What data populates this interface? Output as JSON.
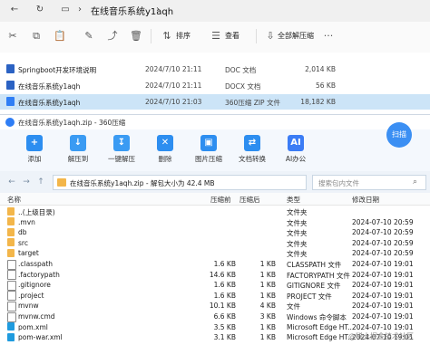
{
  "explorer": {
    "breadcrumb": "在线音乐系统y1aqh",
    "toolbar": {
      "sort_label": "排序",
      "view_label": "查看",
      "extract_all_label": "全部解压缩"
    },
    "files": [
      {
        "name": "Springboot开发环境说明",
        "date": "2024/7/10 21:11",
        "type": "DOC 文档",
        "size": "2,014 KB",
        "icon_color": "#2b62c3",
        "selected": false
      },
      {
        "name": "在线音乐系统y1aqh",
        "date": "2024/7/10 21:11",
        "type": "DOCX 文档",
        "size": "56 KB",
        "icon_color": "#2b62c3",
        "selected": false
      },
      {
        "name": "在线音乐系统y1aqh",
        "date": "2024/7/10 21:03",
        "type": "360压缩 ZIP 文件",
        "size": "18,182 KB",
        "icon_color": "#2f7ef5",
        "selected": true
      }
    ]
  },
  "zip": {
    "title": "在线音乐系统y1aqh.zip - 360压缩",
    "ribbon": [
      {
        "label": "添加",
        "icon": "add-icon",
        "color": "#2d8ef0",
        "glyph": "+"
      },
      {
        "label": "解压到",
        "icon": "extract-to-icon",
        "color": "#3a9bf3",
        "glyph": "↓"
      },
      {
        "label": "一键解压",
        "icon": "one-click-extract-icon",
        "color": "#3a9bf3",
        "glyph": "↧"
      },
      {
        "label": "删除",
        "icon": "trash-icon",
        "color": "#2d8ef0",
        "glyph": "✕"
      },
      {
        "label": "图片压缩",
        "icon": "image-compress-icon",
        "color": "#2d8ef0",
        "glyph": "▣"
      },
      {
        "label": "文档转换",
        "icon": "doc-convert-icon",
        "color": "#2d8ef0",
        "glyph": "⇄"
      },
      {
        "label": "AI办公",
        "icon": "ai-office-icon",
        "color": "#3b7cf5",
        "glyph": "AI"
      }
    ],
    "scan_label": "扫描",
    "address": "在线音乐系统y1aqh.zip - 解包大小为 42.4 MB",
    "search_placeholder": "搜索包内文件",
    "columns": {
      "name": "名称",
      "compressed": "压缩前",
      "size_after": "压缩后",
      "type": "类型",
      "modified": "修改日期"
    },
    "rows": [
      {
        "name": "..(上级目录)",
        "before": "",
        "after": "",
        "type": "文件夹",
        "date": "",
        "icon_color": "#f3b64a"
      },
      {
        "name": ".mvn",
        "before": "",
        "after": "",
        "type": "文件夹",
        "date": "2024-07-10 20:59",
        "icon_color": "#f3b64a"
      },
      {
        "name": "db",
        "before": "",
        "after": "",
        "type": "文件夹",
        "date": "2024-07-10 20:59",
        "icon_color": "#f3b64a"
      },
      {
        "name": "src",
        "before": "",
        "after": "",
        "type": "文件夹",
        "date": "2024-07-10 20:59",
        "icon_color": "#f3b64a"
      },
      {
        "name": "target",
        "before": "",
        "after": "",
        "type": "文件夹",
        "date": "2024-07-10 20:59",
        "icon_color": "#f3b64a"
      },
      {
        "name": ".classpath",
        "before": "1.6 KB",
        "after": "1 KB",
        "type": "CLASSPATH 文件",
        "date": "2024-07-10 19:01",
        "icon_color": "#ffffff"
      },
      {
        "name": ".factorypath",
        "before": "14.6 KB",
        "after": "1 KB",
        "type": "FACTORYPATH 文件",
        "date": "2024-07-10 19:01",
        "icon_color": "#ffffff"
      },
      {
        "name": ".gitignore",
        "before": "1.6 KB",
        "after": "1 KB",
        "type": "GITIGNORE 文件",
        "date": "2024-07-10 19:01",
        "icon_color": "#ffffff"
      },
      {
        "name": ".project",
        "before": "1.6 KB",
        "after": "1 KB",
        "type": "PROJECT 文件",
        "date": "2024-07-10 19:01",
        "icon_color": "#ffffff"
      },
      {
        "name": "mvnw",
        "before": "10.1 KB",
        "after": "4 KB",
        "type": "文件",
        "date": "2024-07-10 19:01",
        "icon_color": "#ffffff"
      },
      {
        "name": "mvnw.cmd",
        "before": "6.6 KB",
        "after": "3 KB",
        "type": "Windows 命令脚本",
        "date": "2024-07-10 19:01",
        "icon_color": "#ffffff"
      },
      {
        "name": "pom.xml",
        "before": "3.5 KB",
        "after": "1 KB",
        "type": "Microsoft Edge HT...",
        "date": "2024-07-10 19:01",
        "icon_color": "#1f9bde"
      },
      {
        "name": "pom-war.xml",
        "before": "3.1 KB",
        "after": "1 KB",
        "type": "Microsoft Edge HT...",
        "date": "2024-07-10 19:01",
        "icon_color": "#1f9bde"
      }
    ]
  },
  "watermark": "@稀土掘金技术社区"
}
